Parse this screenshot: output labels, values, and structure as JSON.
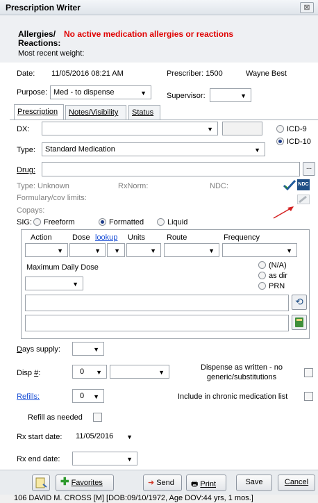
{
  "window": {
    "title": "Prescription Writer",
    "close_glyph": "⊠"
  },
  "header": {
    "allergies_label": "Allergies/",
    "reactions_label": "Reactions:",
    "allergies_value": "No active medication allergies or reactions",
    "weight_label": "Most recent weight:"
  },
  "info": {
    "date_label": "Date:",
    "date_value": "11/05/2016 08:21 AM",
    "prescriber_label": "Prescriber: 1500",
    "prescriber_name": "Wayne Best",
    "purpose_label": "Purpose:",
    "purpose_value": "Med - to dispense",
    "supervisor_label": "Supervisor:"
  },
  "tabs": [
    "Prescription",
    "Notes/Visibility",
    "Status"
  ],
  "rx": {
    "dx_label": "DX:",
    "icd9": "ICD-9",
    "icd10": "ICD-10",
    "type_label": "Type:",
    "type_value": "Standard Medication",
    "drug_label": "Drug:",
    "drug_button": "...",
    "type_info": "Type: Unknown",
    "rxnorm": "RxNorm:",
    "ndc": "NDC:",
    "formulary": "Formulary/cov limits:",
    "copays": "Copays:",
    "sig_label": "SIG:",
    "sig_options": [
      "Freeform",
      "Formatted",
      "Liquid"
    ],
    "sig_selected": "Formatted"
  },
  "sig": {
    "action": "Action",
    "dose": "Dose",
    "lookup": "lookup",
    "units": "Units",
    "route": "Route",
    "frequency": "Frequency",
    "max_daily": "Maximum Daily Dose",
    "na": "(N/A)",
    "as_dir": "as dir",
    "prn": "PRN"
  },
  "supply": {
    "days_label": "Days supply:",
    "disp_label": "Disp #:",
    "disp_value": "0",
    "daw_label": "Dispense as written - no generic/substitutions",
    "refills_label": "Refills:",
    "refills_value": "0",
    "chronic_label": "Include in chronic medication list",
    "refill_as_needed": "Refill as needed",
    "start_label": "Rx start date:",
    "start_value": "11/05/2016",
    "end_label": "Rx end date:"
  },
  "buttons": {
    "favorites": "Favorites",
    "send": "Send",
    "print": "Print",
    "save": "Save",
    "cancel": "Cancel"
  },
  "status_bar": "106 DAVID M. CROSS [M] [DOB:09/10/1972, Age DOV:44 yrs, 1 mos.]",
  "colors": {
    "allergy_red": "#e00000",
    "link_blue": "#1a4fd6",
    "arrow_red": "#d42020"
  }
}
